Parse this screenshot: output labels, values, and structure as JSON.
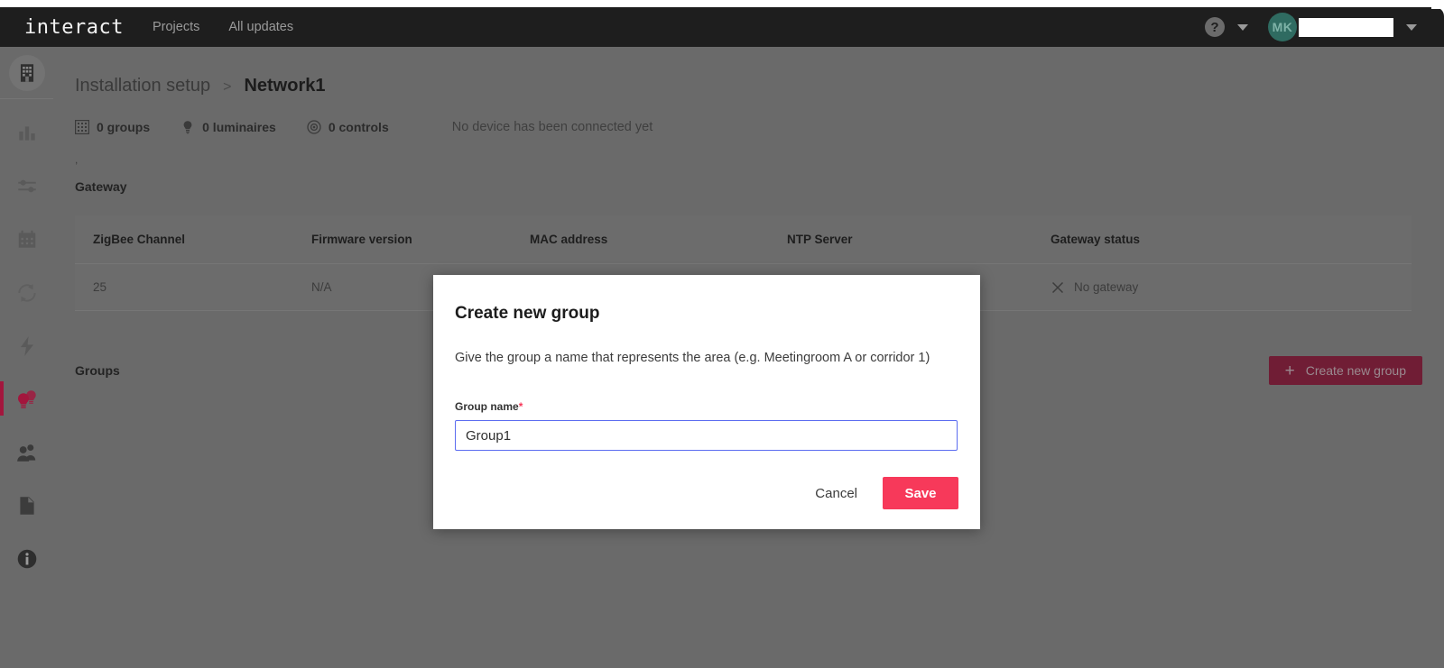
{
  "header": {
    "brand": "interact",
    "nav": [
      {
        "label": "Projects",
        "name": "nav-projects"
      },
      {
        "label": "All updates",
        "name": "nav-all-updates"
      }
    ],
    "help_glyph": "?",
    "avatar_initials": "MK",
    "account_name": ""
  },
  "sidebar": {
    "items": [
      {
        "name": "sidebar-item-building",
        "icon": "building-icon",
        "active": false
      },
      {
        "name": "sidebar-item-reports",
        "icon": "bar-chart-icon",
        "active": false
      },
      {
        "name": "sidebar-item-settings",
        "icon": "sliders-icon",
        "active": false
      },
      {
        "name": "sidebar-item-schedule",
        "icon": "calendar-icon",
        "active": false
      },
      {
        "name": "sidebar-item-sync",
        "icon": "refresh-icon",
        "active": false
      },
      {
        "name": "sidebar-item-energy",
        "icon": "lightning-bolt-icon",
        "active": false
      },
      {
        "name": "sidebar-item-lighting",
        "icon": "lightbulbs-icon",
        "active": true
      },
      {
        "name": "sidebar-item-users",
        "icon": "people-icon",
        "active": false
      },
      {
        "name": "sidebar-item-documents",
        "icon": "document-icon",
        "active": false
      },
      {
        "name": "sidebar-item-info",
        "icon": "info-icon",
        "active": false
      }
    ]
  },
  "breadcrumb": {
    "parent": "Installation setup",
    "separator": ">",
    "current": "Network1"
  },
  "stats": {
    "groups": "0 groups",
    "luminaires": "0 luminaires",
    "controls": "0 controls",
    "note": "No device has been connected yet",
    "artifact": ","
  },
  "gateway": {
    "section_title": "Gateway",
    "columns": [
      "ZigBee Channel",
      "Firmware version",
      "MAC address",
      "NTP Server",
      "Gateway status"
    ],
    "rows": [
      {
        "zigbee_channel": "25",
        "firmware_version": "N/A",
        "mac_address": "",
        "ntp_server": "",
        "gateway_status": "No gateway",
        "status_icon": "close-x-icon"
      }
    ]
  },
  "groups_section": {
    "title": "Groups",
    "create_button": "Create new group",
    "create_button_plus": "+"
  },
  "modal": {
    "title": "Create new group",
    "description": "Give the group a name that represents the area (e.g. Meetingroom A or corridor 1)",
    "field_label": "Group name",
    "required_marker": "*",
    "field_value": "Group1",
    "field_placeholder": "Group name",
    "cancel_label": "Cancel",
    "save_label": "Save"
  },
  "colors": {
    "topbar_bg": "#1e1e1e",
    "page_bg": "#6a6a6a",
    "accent_red": "#a3163d",
    "save_pink": "#f7395a",
    "create_button": "#701d35",
    "avatar_teal": "#2f6b61",
    "input_focus_border": "#5b6cf0"
  }
}
